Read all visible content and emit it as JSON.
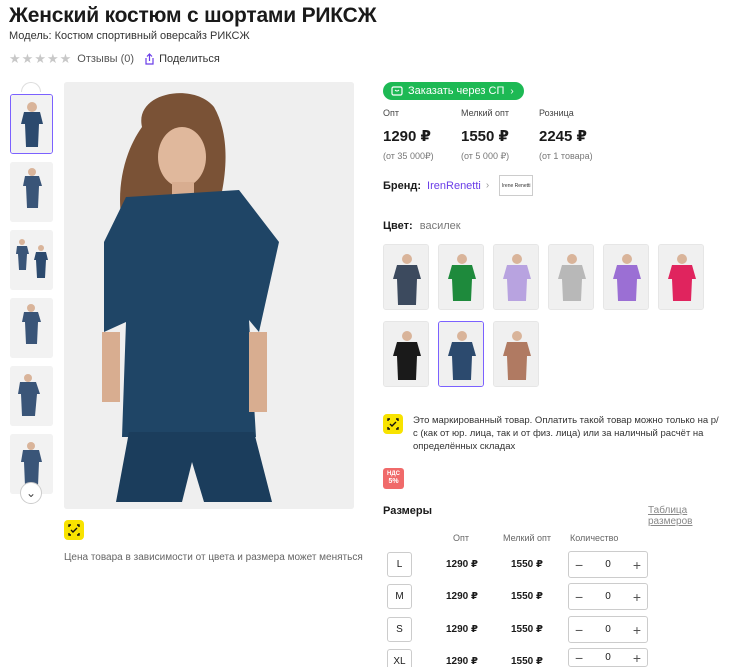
{
  "product": {
    "title": "Женский костюм с шортами РИКСЖ",
    "model_prefix": "Модель: Костюм спортивный оверсайз РИКСЖ",
    "reviews": "Отзывы (0)",
    "share": "Поделиться"
  },
  "gallery": {
    "price_note": "Цена товара в зависимости от цвета и размера может меняться"
  },
  "order": {
    "button_label": "Заказать через СП"
  },
  "prices": [
    {
      "label": "Опт",
      "value": "1290 ₽",
      "note": "(от 35 000₽)"
    },
    {
      "label": "Мелкий опт",
      "value": "1550 ₽",
      "note": "(от 5 000 ₽)"
    },
    {
      "label": "Розница",
      "value": "2245 ₽",
      "note": "(от 1 товара)"
    }
  ],
  "brand": {
    "label": "Бренд:",
    "name": "IrenRenetti",
    "logo_text": "Irene Renetti"
  },
  "color": {
    "label": "Цвет:",
    "value": "василек",
    "swatch_colors": [
      "#3c4a5e",
      "#1e8a3c",
      "#b8a3e0",
      "#b8b8b8",
      "#9b6fd4",
      "#e0245e",
      "#1a1a1a",
      "#2c4a6e",
      "#b07a62"
    ]
  },
  "marking": {
    "text": "Это маркированный товар. Оплатить такой товар можно только на р/с (как от юр. лица, так и от физ. лица) или за наличный расчёт на определённых складах"
  },
  "nds": {
    "line1": "НДС",
    "line2": "5%"
  },
  "sizes": {
    "title": "Размеры",
    "table_link": "Таблица размеров",
    "col_opt": "Опт",
    "col_small": "Мелкий опт",
    "col_qty": "Количество",
    "rows": [
      {
        "size": "L",
        "opt": "1290 ₽",
        "small": "1550 ₽",
        "qty": "0"
      },
      {
        "size": "M",
        "opt": "1290 ₽",
        "small": "1550 ₽",
        "qty": "0"
      },
      {
        "size": "S",
        "opt": "1290 ₽",
        "small": "1550 ₽",
        "qty": "0"
      },
      {
        "size": "XL",
        "opt": "1290 ₽",
        "small": "1550 ₽",
        "qty": "0"
      }
    ]
  }
}
